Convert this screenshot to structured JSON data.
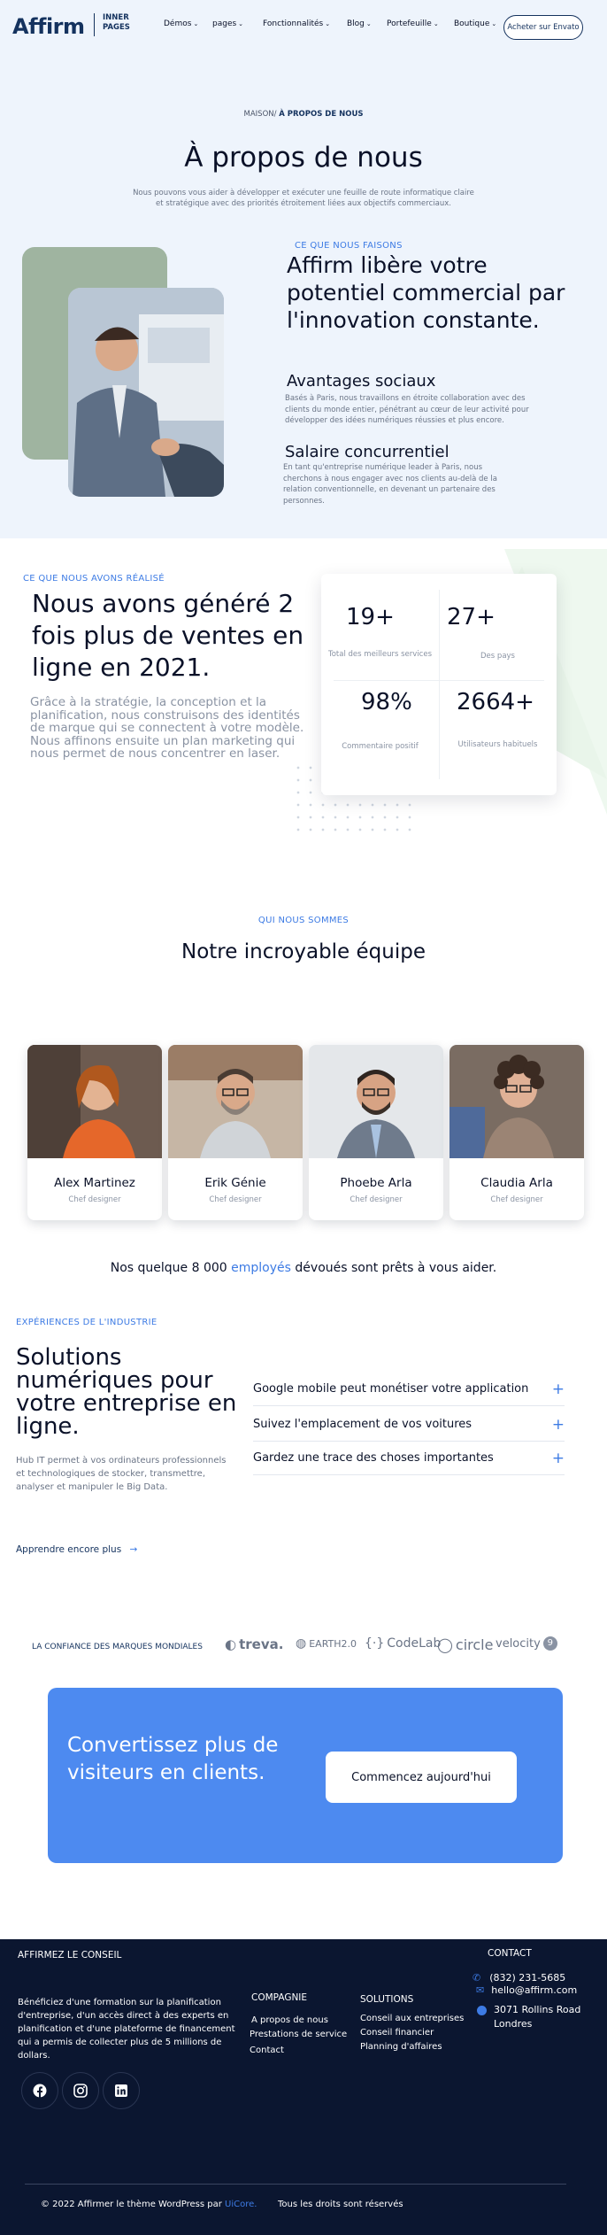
{
  "header": {
    "logo": "Affirm",
    "logo_sub_1": "INNER",
    "logo_sub_2": "PAGES",
    "nav": [
      "Démos",
      "pages",
      "Fonctionnalités",
      "Blog",
      "Portefeuille",
      "Boutique"
    ],
    "cta": "Acheter sur Envato"
  },
  "hero": {
    "crumb_home": "MAISON/",
    "crumb_current": "À PROPOS DE NOUS",
    "title": "À propos de nous",
    "lead": "Nous pouvons vous aider à développer et exécuter une feuille de route informatique claire et stratégique avec des priorités étroitement liées aux objectifs commerciaux."
  },
  "about": {
    "eyebrow": "CE QUE NOUS FAISONS",
    "title": "Affirm libère votre potentiel commercial par l'innovation constante.",
    "f1_title": "Avantages sociaux",
    "f1_text": "Basés à Paris, nous travaillons en étroite collaboration avec des clients du monde entier, pénétrant au cœur de leur activité pour développer des idées numériques réussies et plus encore.",
    "f2_title": "Salaire concurrentiel",
    "f2_text": "En tant qu'entreprise numérique leader à Paris, nous cherchons à nous engager avec nos clients au-delà de la relation conventionnelle, en devenant un partenaire des personnes."
  },
  "stats": {
    "eyebrow": "CE QUE NOUS AVONS RÉALISÉ",
    "title": "Nous avons généré 2 fois plus de ventes en ligne en 2021.",
    "text": "Grâce à la stratégie, la conception et la planification, nous construisons des identités de marque qui se connectent à votre modèle. Nous affinons ensuite un plan marketing qui nous permet de nous concentrer en laser.",
    "items": [
      {
        "value": "19+",
        "label": "Total des meilleurs services"
      },
      {
        "value": "27+",
        "label": "Des pays"
      },
      {
        "value": "98%",
        "label": "Commentaire positif"
      },
      {
        "value": "2664+",
        "label": "Utilisateurs habituels"
      }
    ]
  },
  "team": {
    "eyebrow": "QUI NOUS SOMMES",
    "title": "Notre incroyable équipe",
    "members": [
      {
        "name": "Alex Martinez",
        "role": "Chef designer"
      },
      {
        "name": "Erik Génie",
        "role": "Chef designer"
      },
      {
        "name": "Phoebe Arla",
        "role": "Chef designer"
      },
      {
        "name": "Claudia Arla",
        "role": "Chef designer"
      }
    ],
    "note_pre": "Nos quelque 8 000",
    "note_hl": "employés",
    "note_post": "dévoués sont prêts à vous aider."
  },
  "industry": {
    "eyebrow": "EXPÉRIENCES DE L'INDUSTRIE",
    "title": "Solutions numériques pour votre entreprise en ligne.",
    "text": "Hub IT permet à vos ordinateurs professionnels et technologiques de stocker, transmettre, analyser et manipuler le Big Data.",
    "accordion": [
      "Google mobile peut monétiser votre application",
      "Suivez l'emplacement de vos voitures",
      "Gardez une trace des choses importantes"
    ],
    "link": "Apprendre encore plus"
  },
  "brands": {
    "label": "LA CONFIANCE DES MARQUES MONDIALES",
    "names": [
      "treva.",
      "EARTH2.0",
      "CodeLab",
      "circle",
      "velocity"
    ]
  },
  "cta": {
    "title": "Convertissez plus de visiteurs en clients.",
    "button": "Commencez aujourd'hui"
  },
  "footer": {
    "brand_title": "AFFIRMEZ LE CONSEIL",
    "brand_text": "Bénéficiez d'une formation sur la planification d'entreprise, d'un accès direct à des experts en planification et d'une plateforme de financement qui a permis de collecter plus de 5 millions de dollars.",
    "company_title": "COMPAGNIE",
    "company_links": [
      "A propos de nous",
      "Prestations de service",
      "Contact"
    ],
    "solutions_title": "SOLUTIONS",
    "solutions_links": [
      "Conseil aux entreprises",
      "Conseil financier",
      "Planning d'affaires"
    ],
    "contact_title": "CONTACT",
    "phone": "(832) 231-5685",
    "email": "hello@affirm.com",
    "address_1": "3071 Rollins Road",
    "address_2": "Londres",
    "copyright_pre": "© 2022 Affirmer le thème WordPress par",
    "copyright_link": "UiCore.",
    "rights": "Tous les droits sont réservés"
  },
  "colors": {
    "accent": "#3d7be4",
    "dark": "#0b1630",
    "brand": "#14325e"
  }
}
